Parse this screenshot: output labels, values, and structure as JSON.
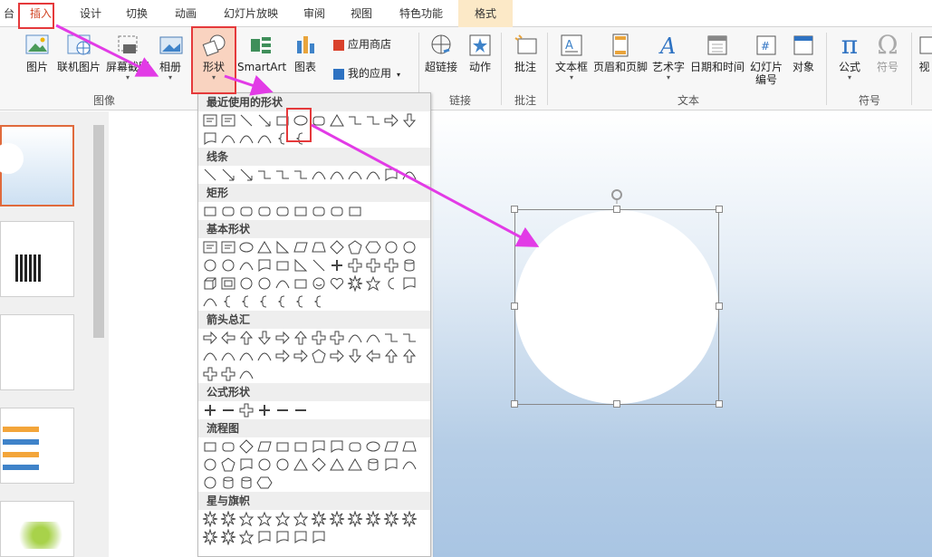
{
  "tabs": [
    {
      "key": "left",
      "label": "台"
    },
    {
      "key": "insert",
      "label": "插入"
    },
    {
      "key": "design",
      "label": "设计"
    },
    {
      "key": "transitions",
      "label": "切换"
    },
    {
      "key": "animations",
      "label": "动画"
    },
    {
      "key": "slideshow",
      "label": "幻灯片放映"
    },
    {
      "key": "review",
      "label": "审阅"
    },
    {
      "key": "view",
      "label": "视图"
    },
    {
      "key": "special",
      "label": "特色功能"
    },
    {
      "key": "format",
      "label": "格式"
    }
  ],
  "ribbon": {
    "picture": "图片",
    "online_picture": "联机图片",
    "screenshot": "屏幕截图",
    "album": "相册",
    "shapes": "形状",
    "smartart": "SmartArt",
    "chart": "图表",
    "app_store": "应用商店",
    "my_apps": "我的应用",
    "hyperlink": "超链接",
    "action": "动作",
    "comment": "批注",
    "textbox": "文本框",
    "header_footer": "页眉和页脚",
    "wordart": "艺术字",
    "datetime": "日期和时间",
    "slide_number_1": "幻灯片",
    "slide_number_2": "编号",
    "object": "对象",
    "equation": "公式",
    "symbol": "符号",
    "video": "视",
    "groups": {
      "images": "图像",
      "links": "链接",
      "comments": "批注",
      "text": "文本",
      "symbols": "符号"
    }
  },
  "gallery": {
    "recent": "最近使用的形状",
    "lines": "线条",
    "rectangles": "矩形",
    "basic": "基本形状",
    "arrows": "箭头总汇",
    "equation": "公式形状",
    "flowchart": "流程图",
    "stars": "星与旗帜"
  },
  "colors": {
    "highlight": "#e5393b",
    "arrow": "#e23be6",
    "accent": "#d24726"
  }
}
